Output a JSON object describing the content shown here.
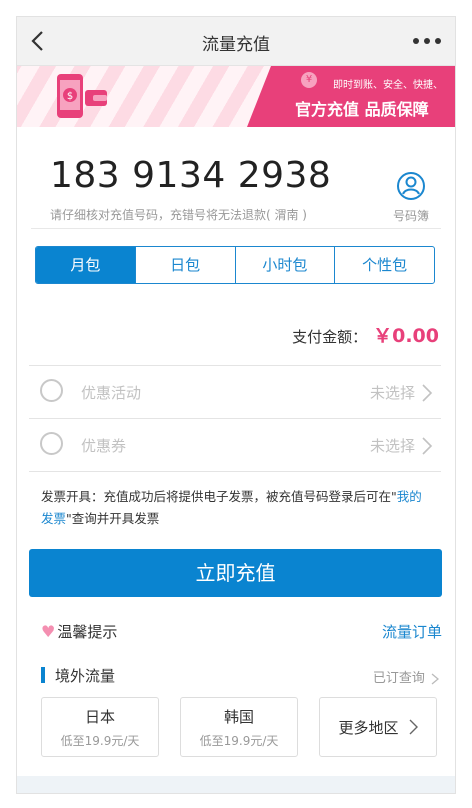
{
  "nav": {
    "title": "流量充值"
  },
  "banner": {
    "sub": "即时到账、安全、快捷、",
    "main": "官方充值 品质保障",
    "yen": "¥"
  },
  "phone": {
    "number": "183 9134 2938",
    "hint": "请仔细核对充值号码，充错号将无法退款( 渭南 )",
    "contacts_label": "号码簿"
  },
  "tabs": [
    {
      "label": "月包",
      "active": true
    },
    {
      "label": "日包"
    },
    {
      "label": "小时包"
    },
    {
      "label": "个性包"
    }
  ],
  "payment": {
    "label": "支付金额：",
    "amount": "￥0.00"
  },
  "discount_activity": {
    "label": "优惠活动",
    "value": "未选择"
  },
  "coupon": {
    "label": "优惠券",
    "value": "未选择"
  },
  "invoice": {
    "text1": "发票开具：充值成功后将提供电子发票，被充值号码登录后可在\"",
    "link": "我的发票",
    "text2": "\"查询并开具发票"
  },
  "charge_button": "立即充值",
  "tips": {
    "heart": "♥",
    "label": "温馨提示",
    "order_link": "流量订单"
  },
  "overseas": {
    "title": "境外流量",
    "query": "已订查询",
    "cards": [
      {
        "name": "日本",
        "price": "低至19.9元/天"
      },
      {
        "name": "韩国",
        "price": "低至19.9元/天"
      }
    ],
    "more": "更多地区"
  },
  "colors": {
    "primary": "#0a84d0",
    "accent": "#e8407a",
    "link": "#1b87cf"
  }
}
